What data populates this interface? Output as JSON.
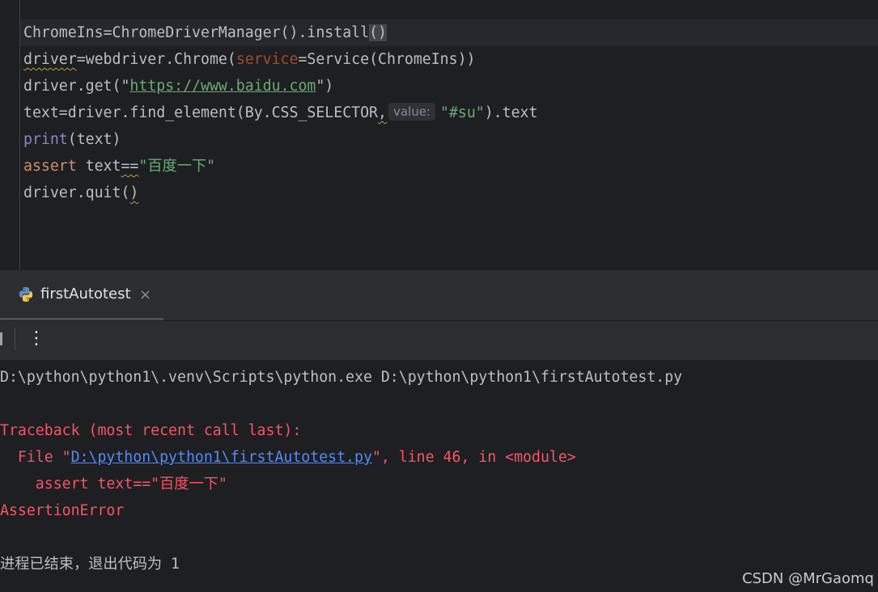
{
  "editor": {
    "lines": [
      {
        "a": "ChromeIns",
        "b": "=ChromeDriverManager().install",
        "c": "(",
        "d": ")"
      },
      {
        "a": "driver",
        "b": "=webdriver.Chrome(",
        "c": "service",
        "d": "=Service(ChromeIns))"
      },
      {
        "a": "driver.get(\"",
        "b": "https://www.baidu.com",
        "c": "\")"
      },
      {
        "a": "text=driver.find_element(By.CSS_SELECTOR",
        "b": ",",
        "hint": "value:",
        "c": "\"#su\"",
        "d": ").text"
      },
      {
        "a": "print",
        "b": "(text)"
      },
      {
        "a": "assert",
        "b": " ",
        "c": "text",
        "d": "==",
        "e": "\"百度一下\""
      },
      {
        "a": "driver.quit(",
        "b": ")"
      }
    ]
  },
  "run": {
    "tab_label": "firstAutotest",
    "close_glyph": "×",
    "more_glyph": "⋮",
    "output": {
      "cmd": "D:\\python\\python1\\.venv\\Scripts\\python.exe D:\\python\\python1\\firstAutotest.py",
      "traceback": "Traceback (most recent call last):",
      "file_prefix": "  File \"",
      "file_link": "D:\\python\\python1\\firstAutotest.py",
      "file_suffix": "\", line 46, in <module>",
      "assert_prefix": "    assert text==\"",
      "assert_cjk": "百度一下",
      "assert_suffix": "\"",
      "error": "AssertionError",
      "exit": "进程已结束，退出代码为 1"
    }
  },
  "watermark": "CSDN @MrGaomq"
}
